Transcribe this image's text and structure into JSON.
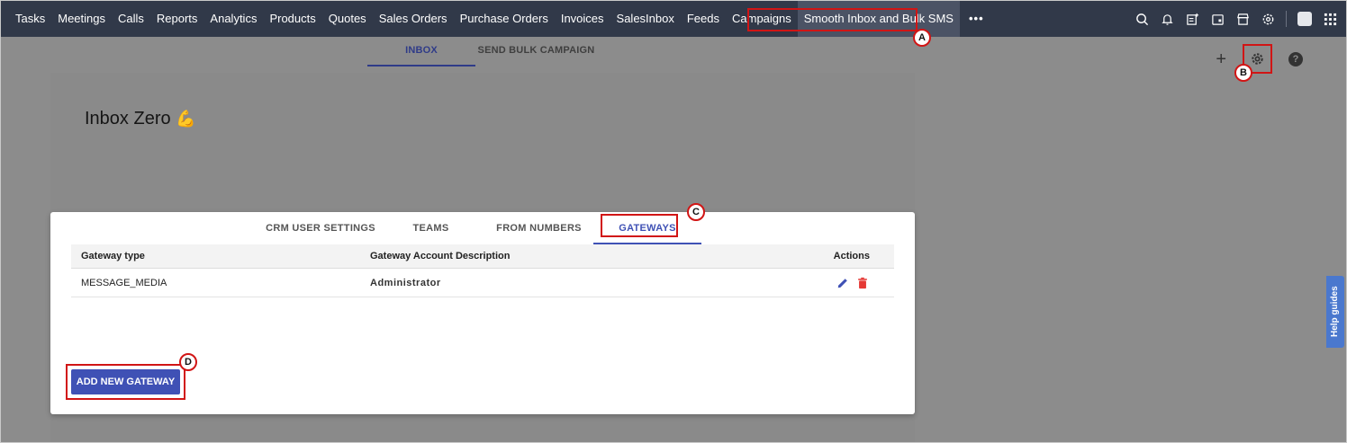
{
  "topnav": {
    "items": [
      "Tasks",
      "Meetings",
      "Calls",
      "Reports",
      "Analytics",
      "Products",
      "Quotes",
      "Sales Orders",
      "Purchase Orders",
      "Invoices",
      "SalesInbox",
      "Feeds",
      "Campaigns",
      "Smooth Inbox and Bulk SMS"
    ],
    "more_label": "•••",
    "icons": [
      "search-icon",
      "bell-icon",
      "add-note-icon",
      "calendar-icon",
      "store-icon",
      "settings-icon",
      "avatar",
      "apps-grid-icon"
    ]
  },
  "subheader": {
    "tabs": [
      "INBOX",
      "SEND BULK CAMPAIGN"
    ],
    "plus": "+",
    "help": "?"
  },
  "inbox": {
    "title": "Inbox Zero",
    "emoji": "💪"
  },
  "modal": {
    "tabs": [
      "CRM USER SETTINGS",
      "TEAMS",
      "FROM NUMBERS",
      "GATEWAYS"
    ],
    "columns": [
      "Gateway type",
      "Gateway Account Description",
      "Actions"
    ],
    "rows": [
      {
        "type": "MESSAGE_MEDIA",
        "description": "Administrator"
      }
    ],
    "add_button": "ADD NEW GATEWAY"
  },
  "annotations": {
    "a": "A",
    "b": "B",
    "c": "C",
    "d": "D"
  },
  "help_guides": "Help guides",
  "colors": {
    "nav_bg": "#313949",
    "accent": "#3f51b5",
    "highlight": "#d11515"
  }
}
